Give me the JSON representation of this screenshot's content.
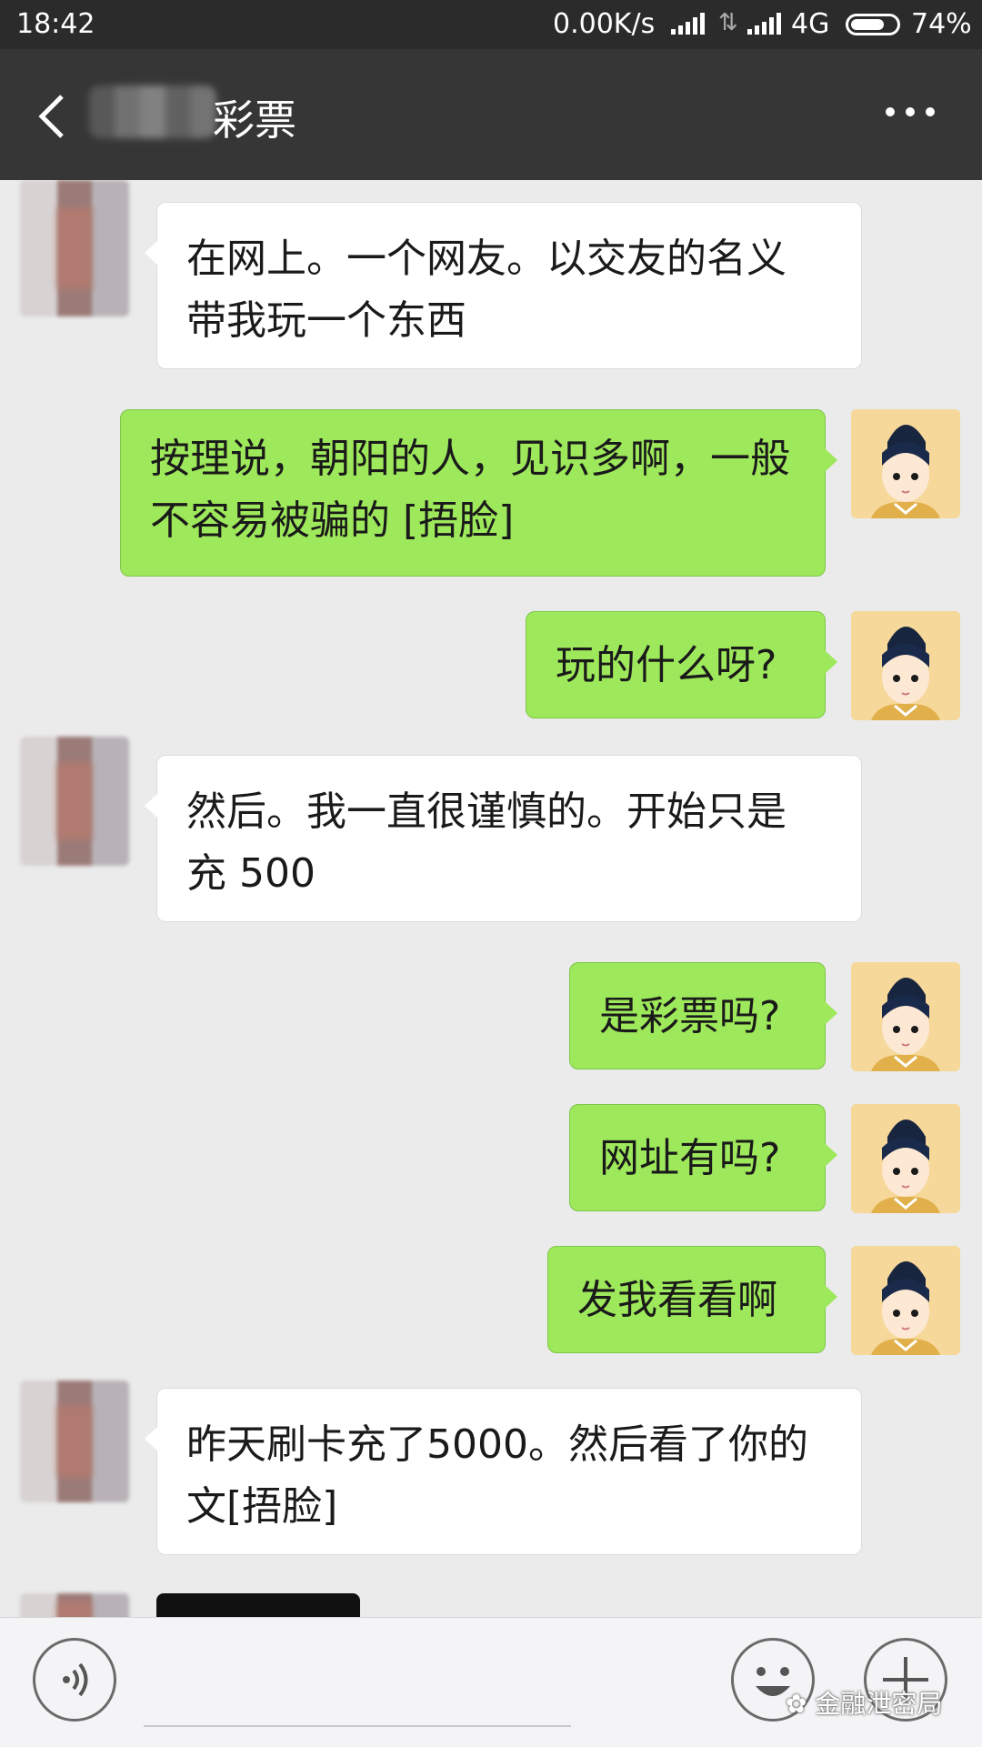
{
  "status_bar": {
    "time": "18:42",
    "network_speed": "0.00K/s",
    "network_type": "4G",
    "battery": "74%",
    "battery_level": 0.74
  },
  "nav": {
    "title": "彩票"
  },
  "messages": [
    {
      "side": "left",
      "lines": [
        "在网上。一个网友。以交友的名义",
        "带我玩一个东西"
      ]
    },
    {
      "side": "right",
      "lines": [
        "按理说，朝阳的人，见识多啊，一般",
        "不容易被骗的 [捂脸]"
      ]
    },
    {
      "side": "right",
      "lines": [
        "玩的什么呀?"
      ]
    },
    {
      "side": "left",
      "lines": [
        "然后。我一直很谨慎的。开始只是",
        "充 500"
      ]
    },
    {
      "side": "right",
      "lines": [
        "是彩票吗?"
      ]
    },
    {
      "side": "right",
      "lines": [
        "网址有吗?"
      ]
    },
    {
      "side": "right",
      "lines": [
        "发我看看啊"
      ]
    },
    {
      "side": "left",
      "lines": [
        "昨天刷卡充了5000。然后看了你的",
        "文[捂脸]"
      ]
    }
  ],
  "watermark": "金融泄密局",
  "colors": {
    "bubble_right": "#9ee85b",
    "bubble_left": "#ffffff",
    "nav_bg": "#363636"
  }
}
